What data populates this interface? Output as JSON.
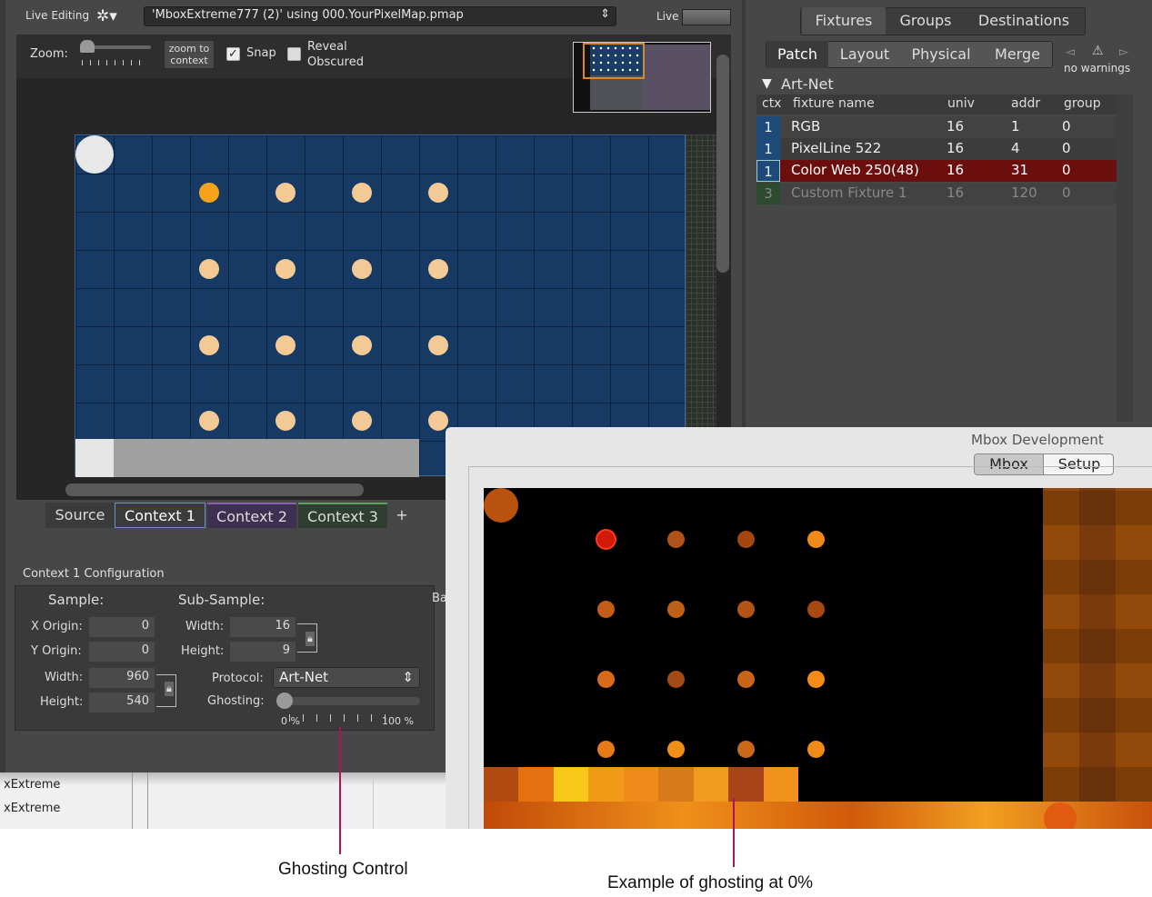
{
  "toolbar": {
    "mode": "Live Editing",
    "file": "'MboxExtreme777 (2)' using 000.YourPixelMap.pmap",
    "live": "Live"
  },
  "zoom": {
    "label": "Zoom:",
    "zoom_to_context_1": "zoom to",
    "zoom_to_context_2": "context",
    "snap": "Snap",
    "reveal_1": "Reveal",
    "reveal_2": "Obscured"
  },
  "context_tabs": [
    "Source",
    "Context 1",
    "Context 2",
    "Context 3",
    "+"
  ],
  "config": {
    "title": "Context 1 Configuration",
    "sample": "Sample:",
    "subsample": "Sub-Sample:",
    "x_origin_label": "X Origin:",
    "x_origin": "0",
    "y_origin_label": "Y Origin:",
    "y_origin": "0",
    "width_label": "Width:",
    "width": "960",
    "height_label": "Height:",
    "height": "540",
    "sub_width_label": "Width:",
    "sub_width": "16",
    "sub_height_label": "Height:",
    "sub_height": "9",
    "protocol_label": "Protocol:",
    "protocol": "Art-Net",
    "ghosting_label": "Ghosting:",
    "ghost_min": "0 %",
    "ghost_max": "100 %",
    "ghosting_level": 0,
    "ba": "Ba"
  },
  "bottom_list": [
    "xExtreme",
    "xExtreme"
  ],
  "right": {
    "tabs": [
      "Fixtures",
      "Groups",
      "Destinations"
    ],
    "subtabs": [
      "Patch",
      "Layout",
      "Physical",
      "Merge"
    ],
    "warnings": "no warnings",
    "group": "Art-Net",
    "columns": [
      "ctx",
      "fixture name",
      "univ",
      "addr",
      "group"
    ],
    "rows": [
      {
        "ctx": "1",
        "name": "RGB",
        "univ": "16",
        "addr": "1",
        "group": "0"
      },
      {
        "ctx": "1",
        "name": "PixelLine 522",
        "univ": "16",
        "addr": "4",
        "group": "0"
      },
      {
        "ctx": "1",
        "name": "Color Web 250(48)",
        "univ": "16",
        "addr": "31",
        "group": "0"
      },
      {
        "ctx": "3",
        "name": "Custom Fixture 1",
        "univ": "16",
        "addr": "120",
        "group": "0"
      }
    ]
  },
  "mbox": {
    "title": "Mbox Development",
    "tabs": [
      "Mbox",
      "Setup"
    ]
  },
  "annotations": {
    "ghosting": "Ghosting Control",
    "example": "Example of ghosting at 0%"
  },
  "colors": {
    "accent": "#b0125e",
    "grid_blue": "#163a63",
    "selected_row": "#6b0e0e"
  }
}
